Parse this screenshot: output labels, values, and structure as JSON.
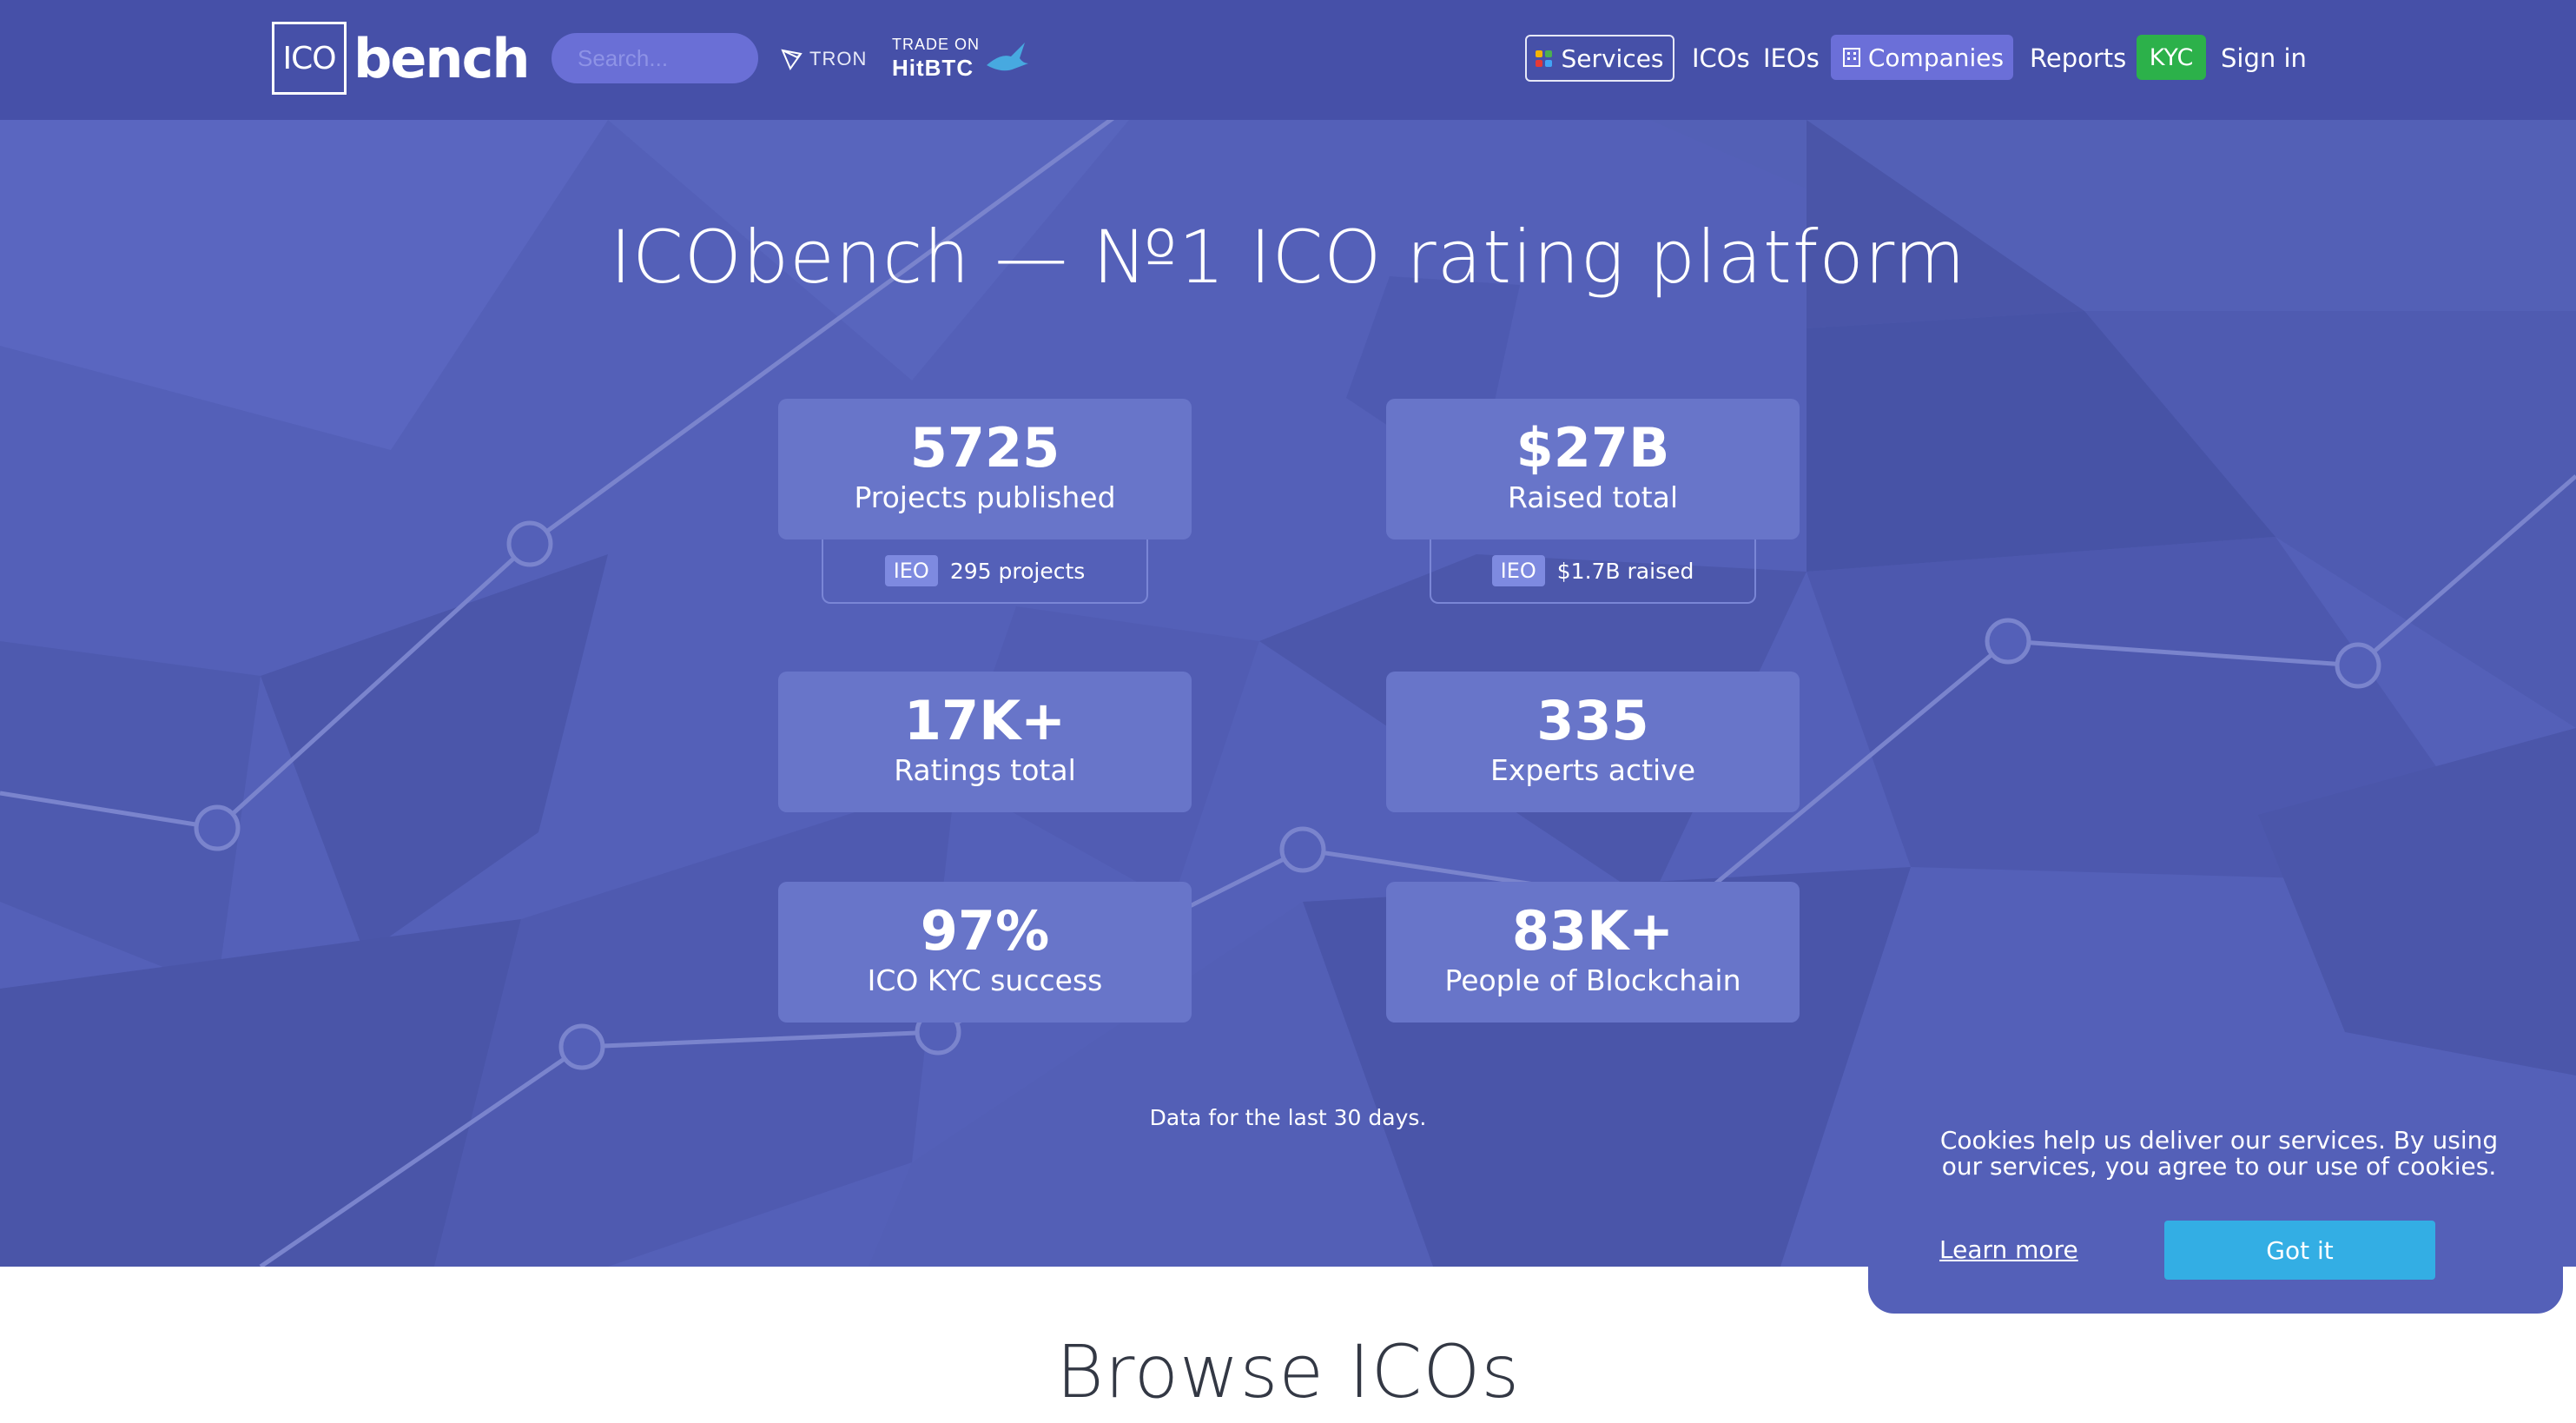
{
  "header": {
    "logo_box": "ICO",
    "logo_word": "bench",
    "search_placeholder": "Search...",
    "tron_label": "TRON",
    "hitbtc_small": "TRADE ON",
    "hitbtc_big": "HitBTC",
    "nav": {
      "services": "Services",
      "icos": "ICOs",
      "ieos": "IEOs",
      "companies": "Companies",
      "reports": "Reports",
      "kyc": "KYC",
      "sign_in": "Sign in"
    }
  },
  "hero": {
    "title": "ICObench — №1 ICO rating platform",
    "stats": [
      {
        "number": "5725",
        "label": "Projects published"
      },
      {
        "number": "$27B",
        "label": "Raised total"
      },
      {
        "number": "17K+",
        "label": "Ratings total"
      },
      {
        "number": "335",
        "label": "Experts active"
      },
      {
        "number": "97%",
        "label": "ICO KYC success"
      },
      {
        "number": "83K+",
        "label": "People of Blockchain"
      }
    ],
    "substats": [
      {
        "badge": "IEO",
        "text": "295 projects"
      },
      {
        "badge": "IEO",
        "text": "$1.7B raised"
      }
    ],
    "note": "Data for the last 30 days."
  },
  "browse_title": "Browse ICOs",
  "cookie": {
    "text": "Cookies help us deliver our services. By using our services, you agree to our use of cookies.",
    "learn_more": "Learn more",
    "got_it": "Got it"
  },
  "colors": {
    "header_bg": "#4650a8",
    "hero_bg": "#5460b8",
    "stat_card": "#6875c9",
    "kyc_green": "#2cb14a",
    "got_it_blue": "#33aee4"
  }
}
